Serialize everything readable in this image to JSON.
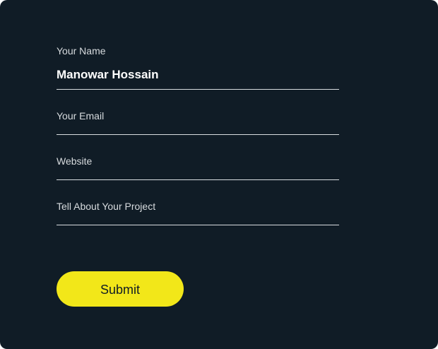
{
  "form": {
    "name": {
      "label": "Your Name",
      "value": "Manowar Hossain"
    },
    "email": {
      "label": "Your Email",
      "value": ""
    },
    "website": {
      "label": "Website",
      "value": ""
    },
    "project": {
      "label": "Tell About Your Project",
      "value": ""
    },
    "submit_label": "Submit"
  },
  "colors": {
    "background": "#101c26",
    "accent": "#f2e719",
    "text": "#ffffff",
    "label": "#d7dbde",
    "underline": "#d9dde0"
  }
}
